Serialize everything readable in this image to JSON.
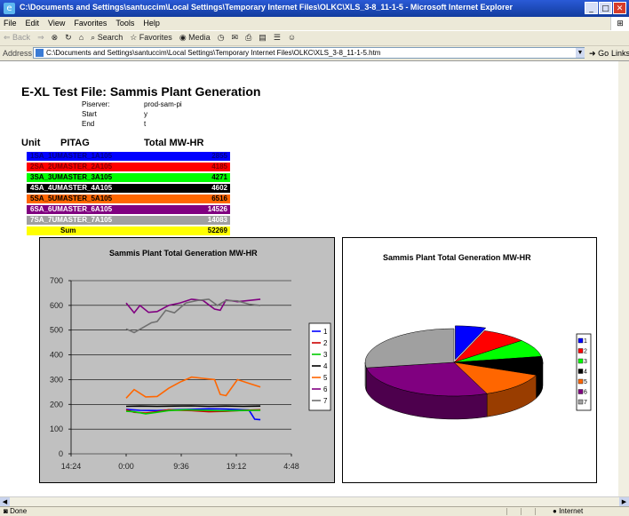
{
  "window": {
    "title": "C:\\Documents and Settings\\santuccim\\Local Settings\\Temporary Internet Files\\OLKC\\XLS_3-8_11-1-5 - Microsoft Internet Explorer",
    "min": "_",
    "max": "□",
    "close": "✕"
  },
  "menu": [
    "File",
    "Edit",
    "View",
    "Favorites",
    "Tools",
    "Help"
  ],
  "toolbar": {
    "back": "⇐ Back",
    "forward": "⇒",
    "stop": "⊗",
    "refresh": "↻",
    "home": "⌂",
    "search": "Search",
    "favorites": "Favorites",
    "media": "Media"
  },
  "address": {
    "label": "Address",
    "url": "C:\\Documents and Settings\\santuccim\\Local Settings\\Temporary Internet Files\\OLKC\\XLS_3-8_11-1-5.htm",
    "go": "Go",
    "links": "Links"
  },
  "status": {
    "text": "Done",
    "zone": "Internet"
  },
  "page": {
    "title": "E-XL Test File: Sammis Plant Generation",
    "meta": [
      {
        "label": "Piserver:",
        "value": "prod-sam-pi"
      },
      {
        "label": "Start",
        "value": "y"
      },
      {
        "label": "End",
        "value": "t"
      }
    ],
    "table": {
      "headers": [
        "Unit",
        "PITAG",
        "Total MW-HR"
      ],
      "rows": [
        {
          "tag": "1SA_1UMASTER_1A105",
          "value": "2855",
          "bg": "#0000ff",
          "fg": "#000080"
        },
        {
          "tag": "2SA_2UMASTER_2A105",
          "value": "4185",
          "bg": "#ff0000",
          "fg": "#800000"
        },
        {
          "tag": "3SA_3UMASTER_3A105",
          "value": "4271",
          "bg": "#00ff00",
          "fg": "#000000"
        },
        {
          "tag": "4SA_4UMASTER_4A105",
          "value": "4602",
          "bg": "#000000",
          "fg": "#ffffff"
        },
        {
          "tag": "5SA_5UMASTER_5A105",
          "value": "6516",
          "bg": "#ff6600",
          "fg": "#000000"
        },
        {
          "tag": "6SA_6UMASTER_6A105",
          "value": "14526",
          "bg": "#800080",
          "fg": "#ffffff"
        },
        {
          "tag": "7SA_7UMASTER_7A105",
          "value": "14083",
          "bg": "#a0a0a0",
          "fg": "#ffffff"
        }
      ],
      "sum": {
        "label": "Sum",
        "value": "52269",
        "bg": "#ffff00"
      }
    }
  },
  "chart_data": [
    {
      "type": "line",
      "title": "Sammis Plant Total Generation MW-HR",
      "xlabel": "",
      "ylabel": "",
      "ylim": [
        0,
        700
      ],
      "yticks": [
        "0",
        "100",
        "200",
        "300",
        "400",
        "500",
        "600",
        "700"
      ],
      "xticks": [
        "14:24",
        "0:00",
        "9:36",
        "19:12",
        "4:48"
      ],
      "x_hours": [
        0,
        9.6,
        19.2,
        28.8,
        38.4
      ],
      "grid": "horizontal",
      "legend": "right",
      "series": [
        {
          "name": "1",
          "color": "#0000ff",
          "x": [
            9.6,
            12,
            15,
            18,
            21,
            24,
            27,
            30,
            31,
            32,
            33
          ],
          "y": [
            180,
            176,
            175,
            178,
            180,
            182,
            181,
            178,
            177,
            140,
            138
          ]
        },
        {
          "name": "2",
          "color": "#cc0000",
          "x": [
            9.6,
            11,
            13,
            15,
            17,
            19,
            21,
            24,
            27,
            30,
            33
          ],
          "y": [
            178,
            168,
            165,
            170,
            178,
            176,
            175,
            170,
            172,
            176,
            178
          ]
        },
        {
          "name": "3",
          "color": "#00cc00",
          "x": [
            9.6,
            11,
            13,
            15,
            17,
            20,
            23,
            26,
            29,
            33
          ],
          "y": [
            172,
            170,
            162,
            168,
            175,
            178,
            176,
            174,
            175,
            176
          ]
        },
        {
          "name": "4",
          "color": "#000000",
          "x": [
            9.6,
            12,
            15,
            18,
            21,
            24,
            27,
            30,
            33
          ],
          "y": [
            192,
            193,
            192,
            193,
            194,
            192,
            193,
            192,
            193
          ]
        },
        {
          "name": "5",
          "color": "#ff6600",
          "x": [
            9.6,
            11,
            13,
            15,
            17,
            19,
            21,
            23,
            25,
            26,
            27,
            29,
            31,
            33
          ],
          "y": [
            225,
            260,
            230,
            232,
            265,
            290,
            310,
            305,
            300,
            240,
            235,
            300,
            285,
            270
          ]
        },
        {
          "name": "6",
          "color": "#800080",
          "x": [
            9.6,
            11,
            12,
            13.5,
            15,
            17,
            19,
            21,
            23,
            25,
            26,
            27,
            29,
            31,
            33
          ],
          "y": [
            610,
            570,
            600,
            572,
            575,
            600,
            610,
            625,
            620,
            585,
            580,
            622,
            615,
            620,
            625
          ]
        },
        {
          "name": "7",
          "color": "#707070",
          "x": [
            9.6,
            11,
            12.5,
            14,
            15,
            16.5,
            18,
            20,
            22,
            24,
            25.5,
            27,
            29,
            31,
            33
          ],
          "y": [
            505,
            490,
            510,
            530,
            535,
            580,
            570,
            610,
            620,
            625,
            600,
            620,
            618,
            605,
            600
          ]
        }
      ]
    },
    {
      "type": "pie",
      "title": "Sammis Plant Total Generation MW-HR",
      "legend": "right",
      "slices": [
        {
          "name": "1",
          "value": 2855,
          "color": "#0000ff"
        },
        {
          "name": "2",
          "value": 4185,
          "color": "#ff0000"
        },
        {
          "name": "3",
          "value": 4271,
          "color": "#00ff00"
        },
        {
          "name": "4",
          "value": 4602,
          "color": "#000000"
        },
        {
          "name": "5",
          "value": 6516,
          "color": "#ff6600"
        },
        {
          "name": "6",
          "value": 14526,
          "color": "#800080"
        },
        {
          "name": "7",
          "value": 14083,
          "color": "#a0a0a0"
        }
      ]
    }
  ]
}
